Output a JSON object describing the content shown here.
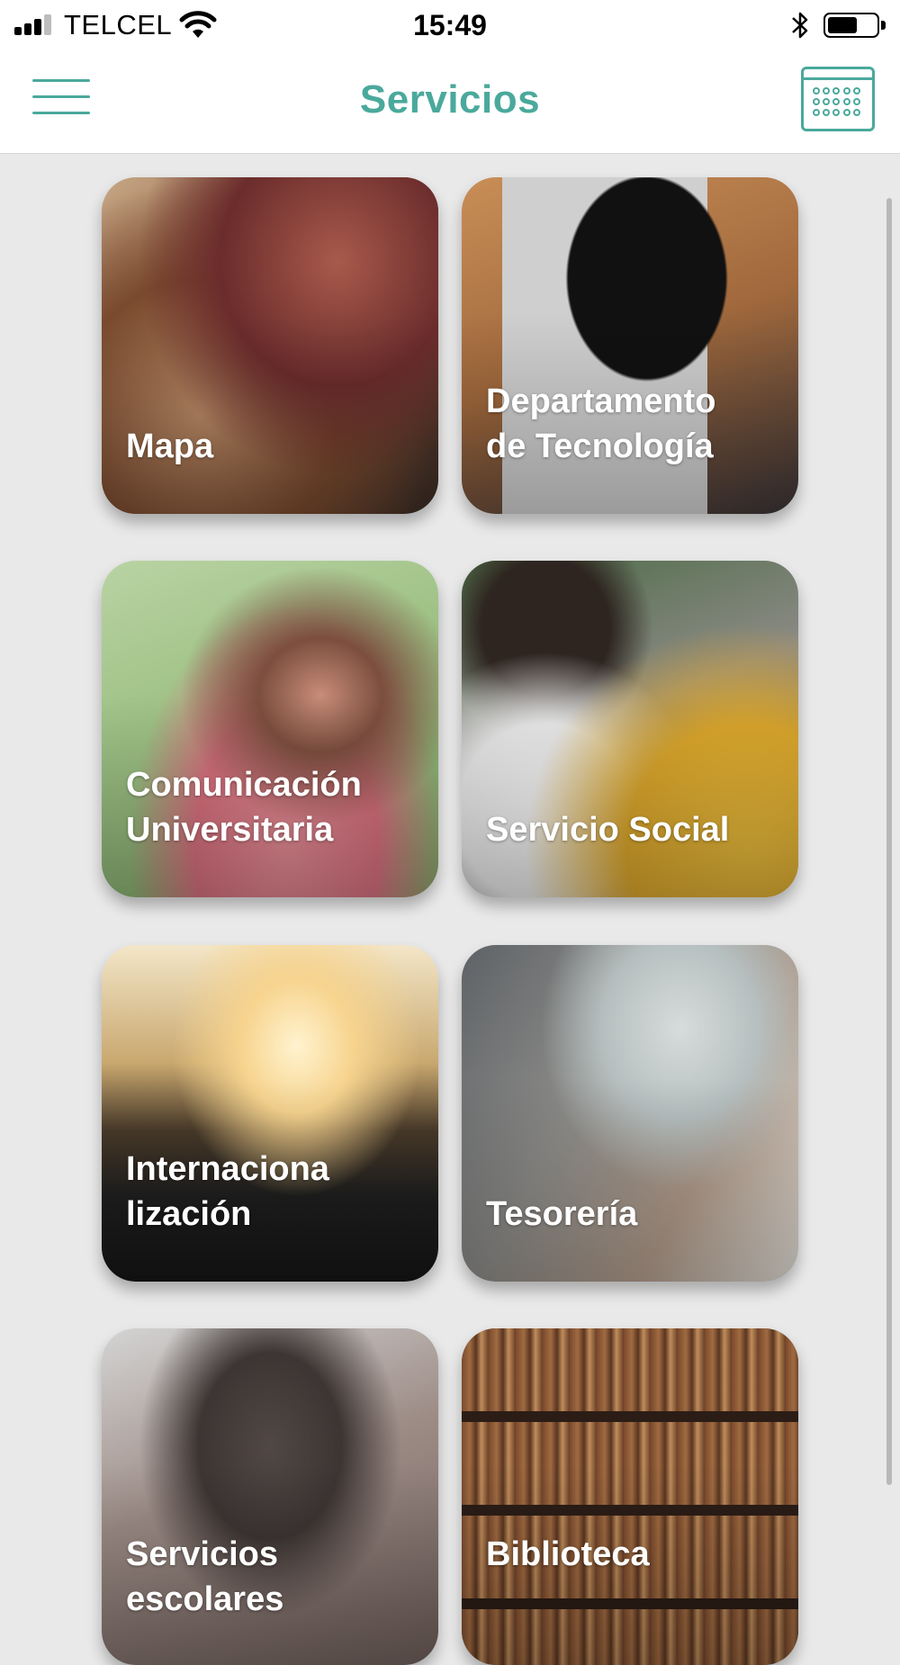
{
  "status_bar": {
    "carrier": "TELCEL",
    "time": "15:49",
    "battery_level": 0.55,
    "icons": [
      "signal-icon",
      "wifi-icon",
      "bluetooth-icon",
      "battery-icon"
    ]
  },
  "header": {
    "title": "Servicios",
    "menu_icon": "hamburger-menu-icon",
    "calendar_icon": "calendar-icon",
    "accent_color": "#4aa99c"
  },
  "services": [
    {
      "label": "Mapa"
    },
    {
      "label": "Departamento\nde Tecnología"
    },
    {
      "label": "Comunicación\nUniversitaria"
    },
    {
      "label": "Servicio Social"
    },
    {
      "label": "Internaciona\nlización"
    },
    {
      "label": "Tesorería"
    },
    {
      "label": "Servicios\nescolares"
    },
    {
      "label": "Biblioteca"
    }
  ]
}
